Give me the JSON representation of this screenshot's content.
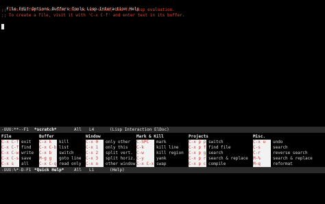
{
  "menubar": {
    "items": [
      "File",
      "Edit",
      "Options",
      "Buffers",
      "Tools",
      "Lisp-Interaction",
      "Help"
    ]
  },
  "scratch": {
    "comment_line_1": ";; This buffer is for text that is not saved, and for Lisp evaluation.",
    "comment_line_2": ";; To create a file, visit it with 'C-x C-f' and enter text in its buffer."
  },
  "modeline_main": {
    "status": "-UUU:**--F1",
    "buffer_name": "*scratch*",
    "position": "All",
    "line": "L4",
    "mode": "(Lisp Interaction ElDoc)"
  },
  "quick_help": {
    "columns": [
      {
        "heading": "File",
        "rows": [
          {
            "key": "C-x C-f",
            "cmd": "exit"
          },
          {
            "key": "C-x C-f",
            "cmd": "find"
          },
          {
            "key": "C-x C-w",
            "cmd": "write"
          },
          {
            "key": "C-x C-s",
            "cmd": "save"
          },
          {
            "key": "C-x s",
            "cmd": "all"
          }
        ]
      },
      {
        "heading": "Buffer",
        "rows": [
          {
            "key": "C-x k",
            "cmd": "kill"
          },
          {
            "key": "C-x C-b",
            "cmd": "list"
          },
          {
            "key": "C-x b",
            "cmd": "switch"
          },
          {
            "key": "M-g g",
            "cmd": "goto line"
          },
          {
            "key": "C-x C-q",
            "cmd": "read only"
          }
        ]
      },
      {
        "heading": "Window",
        "rows": [
          {
            "key": "C-x 0",
            "cmd": "only other"
          },
          {
            "key": "C-x 1",
            "cmd": "only this"
          },
          {
            "key": "C-x 2",
            "cmd": "split vert."
          },
          {
            "key": "C-x 3",
            "cmd": "split horiz."
          },
          {
            "key": "C-x o",
            "cmd": "other window"
          }
        ]
      },
      {
        "heading": "Mark & Kill",
        "rows": [
          {
            "key": "C-SPC",
            "cmd": "mark"
          },
          {
            "key": "C-k",
            "cmd": "kill line"
          },
          {
            "key": "C-w",
            "cmd": "kill region"
          },
          {
            "key": "C-y",
            "cmd": "yank"
          },
          {
            "key": "C-x C-x",
            "cmd": "swap"
          }
        ]
      },
      {
        "heading": "Projects",
        "rows": [
          {
            "key": "C-x p p",
            "cmd": "switch"
          },
          {
            "key": "C-x p f",
            "cmd": "find file"
          },
          {
            "key": "C-x p g",
            "cmd": "search"
          },
          {
            "key": "C-x p r",
            "cmd": "search & replace"
          },
          {
            "key": "C-x p c",
            "cmd": "compile"
          }
        ]
      },
      {
        "heading": "Misc.",
        "rows": [
          {
            "key": "C-x u",
            "cmd": "undo"
          },
          {
            "key": "C-s",
            "cmd": "search"
          },
          {
            "key": "C-r",
            "cmd": "reverse search"
          },
          {
            "key": "M-%",
            "cmd": "search & replace"
          },
          {
            "key": "M-q",
            "cmd": "reformat"
          }
        ]
      }
    ]
  },
  "modeline_help": {
    "status": "-UUU:%*-D-F1",
    "buffer_name": "*Quick Help*",
    "position": "All",
    "line": "L1",
    "mode": "(Help)"
  },
  "colors": {
    "background": "#000000",
    "comment": "#e04a3c",
    "modeline_bg": "#2a2a2a",
    "key_bg": "#f2f2f2",
    "key_fg": "#c8322a"
  }
}
